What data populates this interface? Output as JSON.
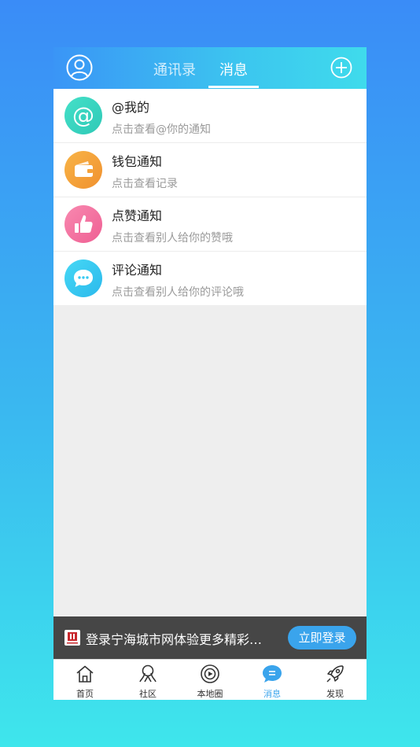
{
  "header": {
    "tabs": [
      {
        "label": "通讯录",
        "active": false
      },
      {
        "label": "消息",
        "active": true
      }
    ],
    "left_icon": "user-icon",
    "right_icon": "plus-circle-icon"
  },
  "messages": [
    {
      "title": "@我的",
      "subtitle": "点击查看@你的通知",
      "icon": "at-icon",
      "color": "#35d6bf"
    },
    {
      "title": "钱包通知",
      "subtitle": "点击查看记录",
      "icon": "wallet-icon",
      "color": "#f5a23a"
    },
    {
      "title": "点赞通知",
      "subtitle": "点击查看别人给你的赞哦",
      "icon": "thumbs-up-icon",
      "color": "#f46fa0"
    },
    {
      "title": "评论通知",
      "subtitle": "点击查看别人给你的评论哦",
      "icon": "comment-icon",
      "color": "#36c9f2"
    }
  ],
  "login_bar": {
    "text": "登录宁海城市网体验更多精彩…",
    "button": "立即登录"
  },
  "tabbar": [
    {
      "label": "首页",
      "icon": "home-icon",
      "active": false
    },
    {
      "label": "社区",
      "icon": "community-icon",
      "active": false
    },
    {
      "label": "本地圈",
      "icon": "local-circle-icon",
      "active": false
    },
    {
      "label": "消息",
      "icon": "message-icon",
      "active": true
    },
    {
      "label": "发现",
      "icon": "rocket-icon",
      "active": false
    }
  ],
  "colors": {
    "accent": "#3aa4ec",
    "header_start": "#3a95f6",
    "header_end": "#3fdbec"
  }
}
